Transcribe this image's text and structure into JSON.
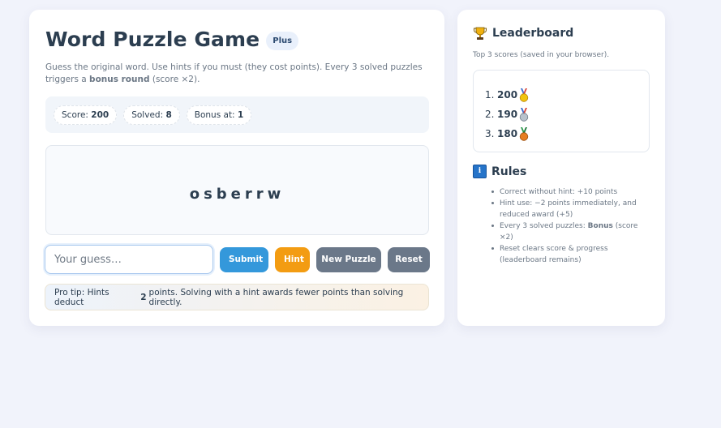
{
  "game": {
    "title": "Word Puzzle Game",
    "badge": "Plus",
    "description_part1": "Guess the original word. Use hints if you must (they cost points). Every 3 solved puzzles triggers a",
    "description_bold": "bonus round",
    "description_part2": "(score ×2).",
    "stats": {
      "score_label": "Score:",
      "score_value": "200",
      "solved_label": "Solved:",
      "solved_value": "8",
      "bonus_label": "Bonus at:",
      "bonus_value": "1"
    },
    "scrambled_word": "osberrw",
    "input": {
      "placeholder": "Your guess…",
      "value": ""
    },
    "buttons": {
      "submit": "Submit",
      "hint": "Hint",
      "new_puzzle": "New Puzzle",
      "reset": "Reset"
    },
    "tip": {
      "prefix": "Pro tip: Hints deduct",
      "points": "2",
      "suffix": "points. Solving with a hint awards fewer points than solving directly."
    }
  },
  "leaderboard": {
    "title": "Leaderboard",
    "icon": "trophy-icon",
    "subtitle": "Top 3 scores (saved in your browser).",
    "entries": [
      {
        "rank": "1.",
        "score": "200",
        "medal": "gold-medal-icon"
      },
      {
        "rank": "2.",
        "score": "190",
        "medal": "silver-medal-icon"
      },
      {
        "rank": "3.",
        "score": "180",
        "medal": "bronze-medal-icon"
      }
    ]
  },
  "rules": {
    "title": "Rules",
    "icon": "info-icon",
    "items": [
      {
        "text": "Correct without hint: +10 points"
      },
      {
        "text": "Hint use: −2 points immediately, and reduced award (+5)"
      },
      {
        "pre": "Every 3 solved puzzles:",
        "bold": "Bonus",
        "post": "(score ×2)"
      },
      {
        "text": "Reset clears score & progress (leaderboard remains)"
      }
    ]
  },
  "colors": {
    "background": "#f1f3fb",
    "text": "#2c3e50",
    "submit": "#3498db",
    "hint": "#f39c12",
    "secondary": "#6b7889",
    "medal_gold": "#f1c40f",
    "medal_silver": "#b8c2cc",
    "medal_bronze": "#e67e22"
  }
}
